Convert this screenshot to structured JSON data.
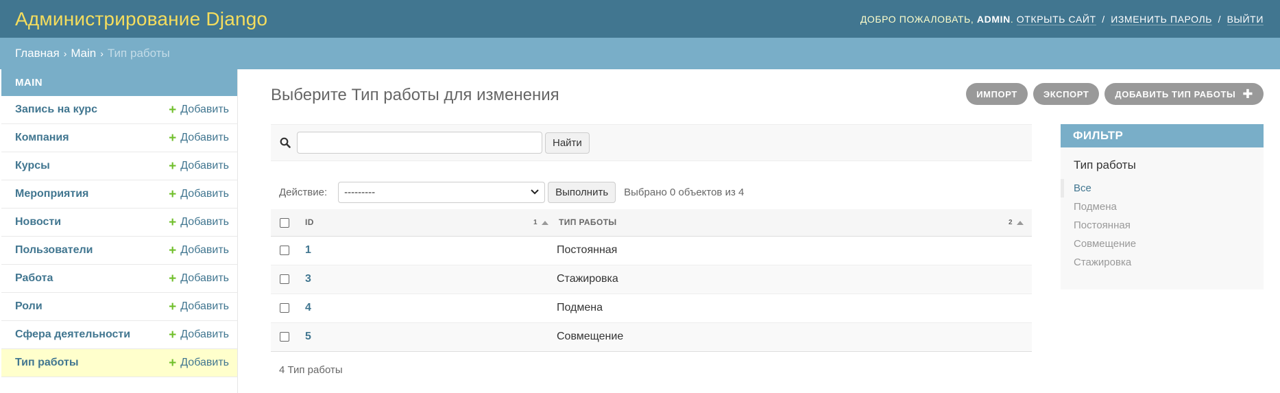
{
  "header": {
    "site_name": "Администрирование Django",
    "welcome": "Добро пожаловать,",
    "username": "admin",
    "view_site": "Открыть сайт",
    "change_password": "Изменить пароль",
    "logout": "Выйти",
    "sep": "/"
  },
  "breadcrumbs": [
    "Главная",
    "Main",
    "Тип работы"
  ],
  "sidebar": {
    "caption": "Main",
    "add_label": "Добавить",
    "items": [
      "Запись на курс",
      "Компания",
      "Курсы",
      "Мероприятия",
      "Новости",
      "Пользователи",
      "Работа",
      "Роли",
      "Сфера деятельности",
      "Тип работы"
    ],
    "current": "Тип работы"
  },
  "page": {
    "title": "Выберите Тип работы для изменения",
    "tools": {
      "import": "Импорт",
      "export": "Экспорт",
      "add": "Добавить Тип работы"
    }
  },
  "search": {
    "value": "",
    "button": "Найти"
  },
  "actions": {
    "label": "Действие:",
    "selected_option": "---------",
    "go": "Выполнить",
    "counter": "Выбрано 0 объектов из 4"
  },
  "table": {
    "columns": [
      {
        "label": "ID",
        "sort_priority": "1"
      },
      {
        "label": "Тип работы",
        "sort_priority": "2"
      }
    ],
    "rows": [
      {
        "id": "1",
        "type": "Постоянная"
      },
      {
        "id": "3",
        "type": "Стажировка"
      },
      {
        "id": "4",
        "type": "Подмена"
      },
      {
        "id": "5",
        "type": "Совмещение"
      }
    ]
  },
  "paginator": "4 Тип работы",
  "filter": {
    "title": "Фильтр",
    "group": "Тип работы",
    "options": [
      "Все",
      "Подмена",
      "Постоянная",
      "Совмещение",
      "Стажировка"
    ],
    "selected": "Все"
  },
  "colors": {
    "header": "#417690",
    "breadcrumbs": "#79aec8",
    "site_name": "#f5dd5d",
    "add_icon": "#70bf2b",
    "current_row": "#ffffcc"
  }
}
